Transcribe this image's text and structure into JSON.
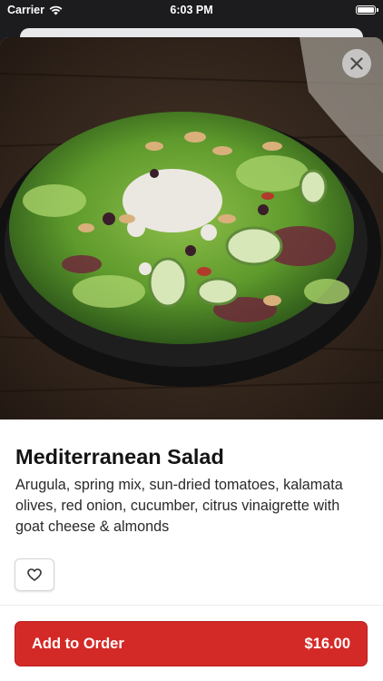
{
  "status_bar": {
    "carrier": "Carrier",
    "time": "6:03 PM",
    "battery_level": 1.0
  },
  "product": {
    "name": "Mediterranean Salad",
    "description": "Arugula, spring mix, sun-dried tomatoes, kalamata olives, red onion, cucumber, citrus vinaigrette with goat cheese & almonds",
    "image_icon": "salad-photo"
  },
  "actions": {
    "close_icon": "close-icon",
    "favorite_icon": "heart-outline-icon",
    "add_label": "Add to Order",
    "price": "$16.00"
  },
  "colors": {
    "accent": "#d42a27",
    "text": "#141414"
  }
}
